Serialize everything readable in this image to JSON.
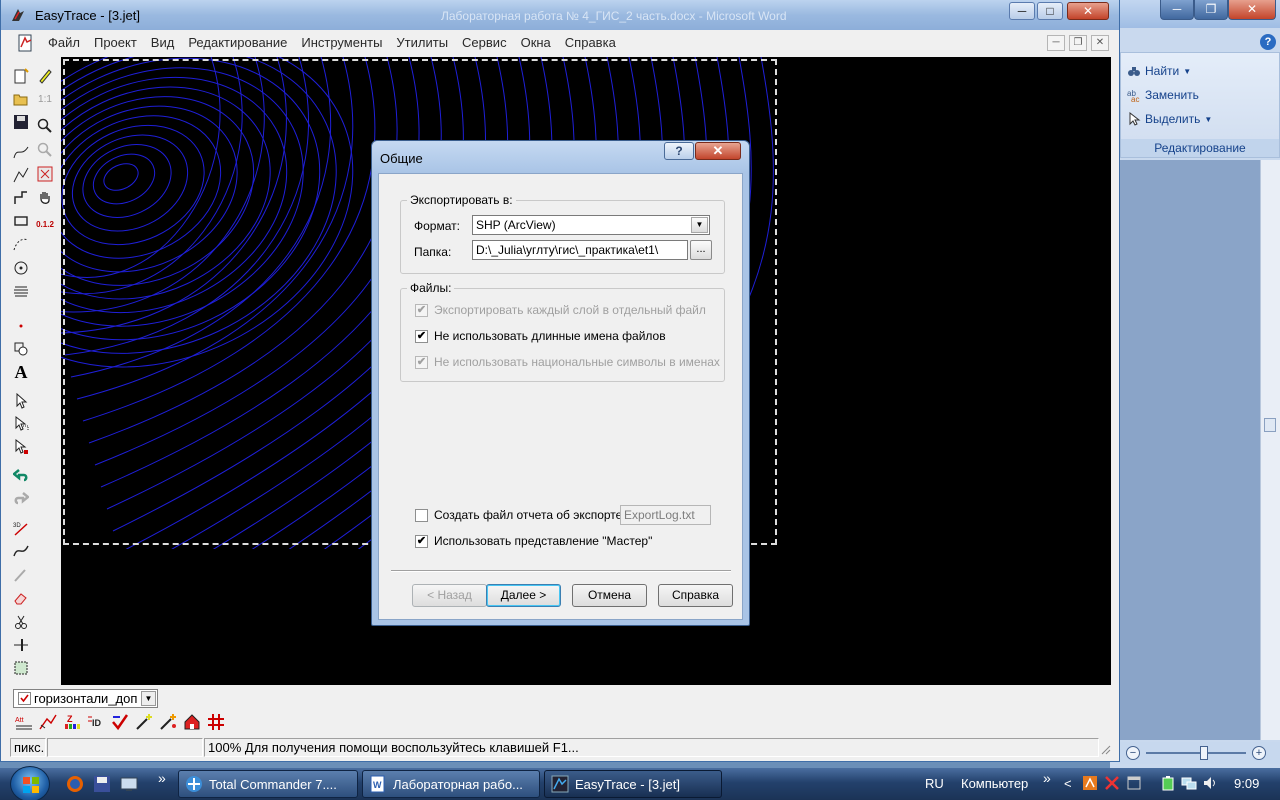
{
  "word_window": {
    "title_buttons": [
      "─",
      "❐",
      "✕"
    ],
    "help_glyph": "?",
    "ribbon": {
      "find_label": "Найти",
      "replace_label": "Заменить",
      "select_label": "Выделить",
      "group_label": "Редактирование"
    },
    "zoom": {
      "minus": "−",
      "plus": "+"
    }
  },
  "app": {
    "title": "EasyTrace - [3.jet]",
    "ghost_title": "Лабораторная работа № 4_ГИС_2 часть.docx - Microsoft Word",
    "caption_buttons": {
      "minimize": "─",
      "maximize": "□",
      "close": "✕"
    },
    "menu": [
      "Файл",
      "Проект",
      "Вид",
      "Редактирование",
      "Инструменты",
      "Утилиты",
      "Сервис",
      "Окна",
      "Справка"
    ],
    "mdi_buttons": {
      "minimize": "─",
      "restore": "❐",
      "close": "✕"
    },
    "toolbar": {
      "ratio_label": "1:1",
      "coord_label": "0.1.2"
    },
    "layer_combo": {
      "value": "горизонтали_доп",
      "dropdown": "▼"
    },
    "bottom_tools": {
      "attr_label": "Att",
      "z_label": "Z",
      "id_label": "ID"
    },
    "status": {
      "units": "пикс.",
      "empty": "",
      "message": "100% Для получения помощи воспользуйтесь клавишей F1..."
    }
  },
  "dialog": {
    "title": "Общие",
    "help_button": "?",
    "close_button": "✕",
    "export_group": {
      "label": "Экспортировать в:",
      "format_label": "Формат:",
      "format_value": "SHP (ArcView)",
      "dropdown_glyph": "▼",
      "folder_label": "Папка:",
      "folder_value": "D:\\_Julia\\углту\\гис\\_практика\\et1\\",
      "browse_label": "..."
    },
    "files_group": {
      "label": "Файлы:",
      "options": [
        {
          "label": "Экспортировать каждый слой в отдельный файл",
          "checked": true,
          "enabled": false
        },
        {
          "label": "Не использовать длинные имена файлов",
          "checked": true,
          "enabled": true
        },
        {
          "label": "Не использовать национальные символы в именах",
          "checked": true,
          "enabled": false
        }
      ]
    },
    "report": {
      "label": "Создать файл отчета об экспорте",
      "checked": false,
      "filename": "ExportLog.txt"
    },
    "wizard": {
      "label": "Использовать представление \"Мастер\"",
      "checked": true
    },
    "check_glyph": "✔",
    "buttons": {
      "back": "< Назад",
      "next": "Далее >",
      "cancel": "Отмена",
      "help": "Справка"
    }
  },
  "taskbar": {
    "quicklaunch": [
      "firefox-icon",
      "save-icon",
      "screen-icon"
    ],
    "overflow_glyph": "»",
    "tasks": [
      {
        "label": "Total Commander 7....",
        "active": false
      },
      {
        "label": "Лабораторная рабо...",
        "active": false
      },
      {
        "label": "EasyTrace - [3.jet]",
        "active": true
      }
    ],
    "language": "RU",
    "toolbar_label": "Компьютер",
    "tray_arrow": "<",
    "clock": "9:09"
  },
  "colors": {
    "contour": "#1f1fd8",
    "canvas": "#000000",
    "titlebar": "#9ab9e0"
  }
}
